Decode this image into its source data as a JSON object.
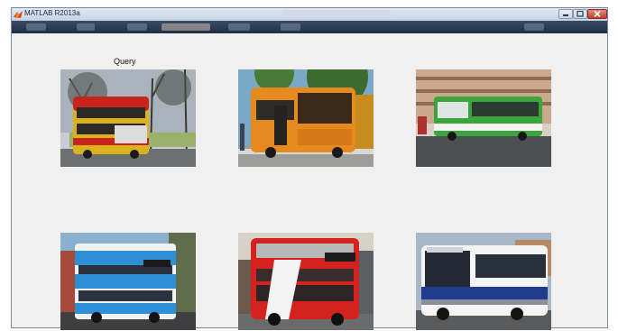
{
  "window": {
    "title": "MATLAB R2013a",
    "icon": "matlab-logo-icon"
  },
  "controls": {
    "minimize_icon": "minimize-icon",
    "maximize_icon": "maximize-icon",
    "close_icon": "close-icon"
  },
  "figure": {
    "query_label": "Query",
    "images": [
      {
        "id": "query",
        "subject": "red-yellow double-decker bus",
        "main_color": "#d9b21c",
        "accent_color": "#c8241c"
      },
      {
        "id": "result-1",
        "subject": "orange single-deck bus",
        "main_color": "#e58a1e",
        "accent_color": "#3b2a1a"
      },
      {
        "id": "result-2",
        "subject": "green articulated bus",
        "main_color": "#3aa53a",
        "accent_color": "#ffffff"
      },
      {
        "id": "result-3",
        "subject": "blue double-decker bus",
        "main_color": "#2f8fd6",
        "accent_color": "#ffffff"
      },
      {
        "id": "result-4",
        "subject": "red double-decker bus",
        "main_color": "#d4231f",
        "accent_color": "#ffffff"
      },
      {
        "id": "result-5",
        "subject": "white-blue single-deck bus",
        "main_color": "#f4f4f4",
        "accent_color": "#1f3c8f"
      }
    ]
  }
}
